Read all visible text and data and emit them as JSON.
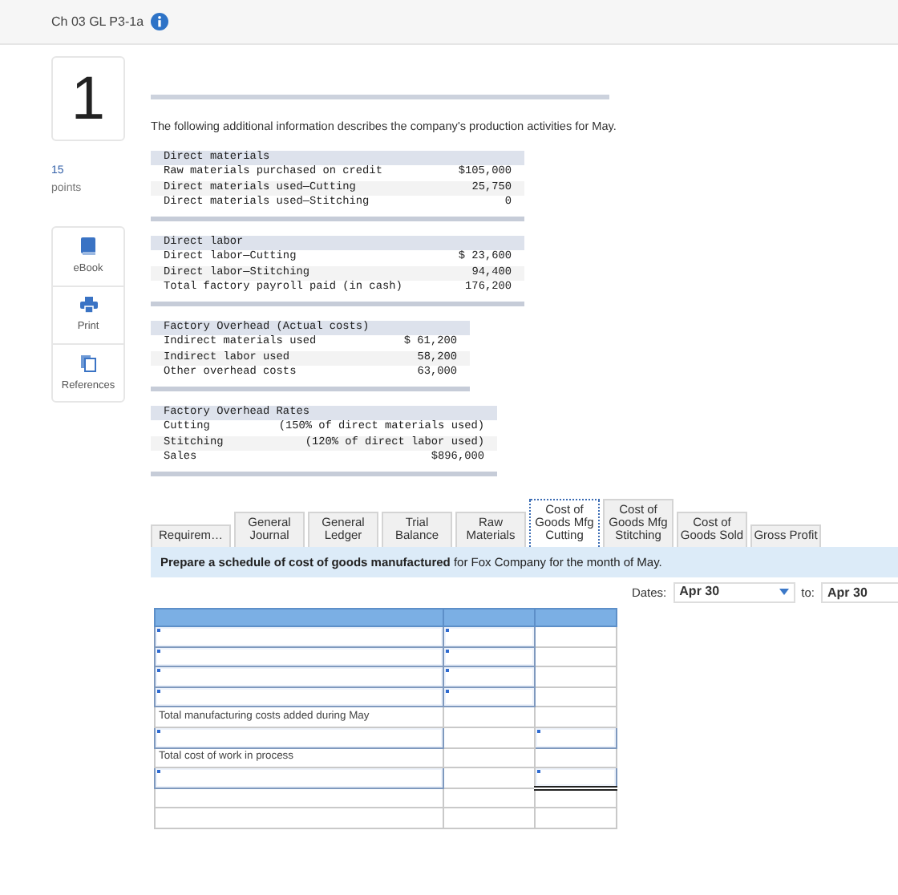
{
  "header": {
    "title": "Ch 03 GL P3-1a"
  },
  "question": {
    "number": "1",
    "points_value": "15",
    "points_label": "points"
  },
  "tools": [
    {
      "kind": "ebook",
      "label": "eBook"
    },
    {
      "kind": "print",
      "label": "Print"
    },
    {
      "kind": "references",
      "label": "References"
    }
  ],
  "intro": "The following additional information describes the company's production activities for May.",
  "data_tables": [
    {
      "heading": "Direct materials",
      "rows": [
        {
          "label": "Raw materials purchased on credit",
          "value": "$105,000"
        },
        {
          "label": "Direct materials used—Cutting",
          "value": "25,750"
        },
        {
          "label": "Direct materials used—Stitching",
          "value": "0"
        }
      ]
    },
    {
      "heading": "Direct labor",
      "rows": [
        {
          "label": "Direct labor—Cutting",
          "value": "$ 23,600"
        },
        {
          "label": "Direct labor—Stitching",
          "value": "94,400"
        },
        {
          "label": "Total factory payroll paid (in cash)",
          "value": "176,200"
        }
      ]
    },
    {
      "heading": "Factory Overhead (Actual costs)",
      "rows": [
        {
          "label": "Indirect materials used",
          "value": "$ 61,200"
        },
        {
          "label": "Indirect labor used",
          "value": "58,200"
        },
        {
          "label": "Other overhead costs",
          "value": "63,000"
        }
      ]
    },
    {
      "heading": "Factory Overhead Rates",
      "rows": [
        {
          "label": "Cutting",
          "value": "(150% of direct materials used)"
        },
        {
          "label": "Stitching",
          "value": "(120% of direct labor used)"
        },
        {
          "label": "Sales",
          "value": "$896,000"
        }
      ]
    }
  ],
  "tabs": [
    {
      "label": "Requirem…",
      "selected": false
    },
    {
      "label": "General Journal",
      "selected": false
    },
    {
      "label": "General Ledger",
      "selected": false
    },
    {
      "label": "Trial Balance",
      "selected": false
    },
    {
      "label": "Raw Materials",
      "selected": false
    },
    {
      "label": "Cost of Goods Mfg Cutting",
      "selected": true
    },
    {
      "label": "Cost of Goods Mfg Stitching",
      "selected": false
    },
    {
      "label": "Cost of Goods Sold",
      "selected": false
    },
    {
      "label": "Gross Profit",
      "selected": false
    }
  ],
  "instruction": "**Prepare a schedule of cost of goods manufactured** for Fox Company for the month of May.",
  "dates": {
    "label": "Dates:",
    "from": "Apr 30",
    "to_label": "to:",
    "to": "Apr 30"
  },
  "schedule": {
    "rows": [
      {
        "cells": [
          {
            "kind": "input"
          },
          {
            "kind": "input"
          },
          {
            "kind": "empty"
          }
        ]
      },
      {
        "cells": [
          {
            "kind": "input"
          },
          {
            "kind": "input"
          },
          {
            "kind": "empty"
          }
        ]
      },
      {
        "cells": [
          {
            "kind": "input"
          },
          {
            "kind": "input"
          },
          {
            "kind": "empty"
          }
        ]
      },
      {
        "cells": [
          {
            "kind": "input"
          },
          {
            "kind": "input"
          },
          {
            "kind": "empty"
          }
        ]
      },
      {
        "cells": [
          {
            "kind": "label",
            "text": "Total manufacturing costs added during May"
          },
          {
            "kind": "empty"
          },
          {
            "kind": "empty"
          }
        ]
      },
      {
        "cells": [
          {
            "kind": "input"
          },
          {
            "kind": "empty"
          },
          {
            "kind": "input"
          }
        ]
      },
      {
        "cells": [
          {
            "kind": "label",
            "text": "Total cost of work in process"
          },
          {
            "kind": "empty"
          },
          {
            "kind": "empty"
          }
        ]
      },
      {
        "cells": [
          {
            "kind": "input"
          },
          {
            "kind": "empty"
          },
          {
            "kind": "input"
          }
        ]
      },
      {
        "cells": [
          {
            "kind": "empty"
          },
          {
            "kind": "empty"
          },
          {
            "kind": "double-rule"
          }
        ]
      },
      {
        "cells": [
          {
            "kind": "empty"
          },
          {
            "kind": "empty"
          },
          {
            "kind": "empty"
          }
        ]
      }
    ]
  }
}
